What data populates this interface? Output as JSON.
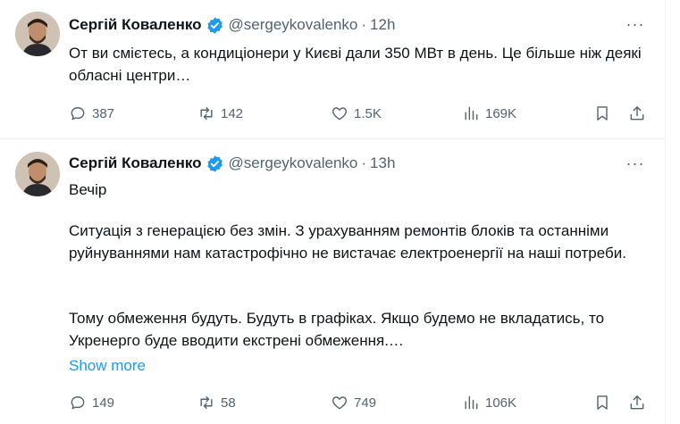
{
  "colors": {
    "accent": "#1d9bf0",
    "text": "#0f1419",
    "muted": "#536471",
    "divider": "#eff3f4"
  },
  "tweets": [
    {
      "author": "Сергій Коваленко",
      "handle": "@sergeykovalenko",
      "separator": "·",
      "time": "12h",
      "more": "···",
      "text_lines": [
        "От ви смієтесь, а кондиціонери у Києві дали 350 МВт в день. Це більше ніж деякі обласні центри…"
      ],
      "replies": "387",
      "reposts": "142",
      "likes": "1.5K",
      "views": "169K"
    },
    {
      "author": "Сергій Коваленко",
      "handle": "@sergeykovalenko",
      "separator": "·",
      "time": "13h",
      "more": "···",
      "p1": "Вечір",
      "p2": "Ситуація з генерацією без змін. З урахуванням ремонтів блоків та останніми руйнуваннями нам катастрофічно не вистачає електроенергії на наші потреби.",
      "p3": "Тому обмеження будуть. Будуть в графіках. Якщо будемо не вкладатись, то Укренерго буде вводити екстрені обмеження.…",
      "show_more": "Show more",
      "replies": "149",
      "reposts": "58",
      "likes": "749",
      "views": "106K"
    }
  ]
}
